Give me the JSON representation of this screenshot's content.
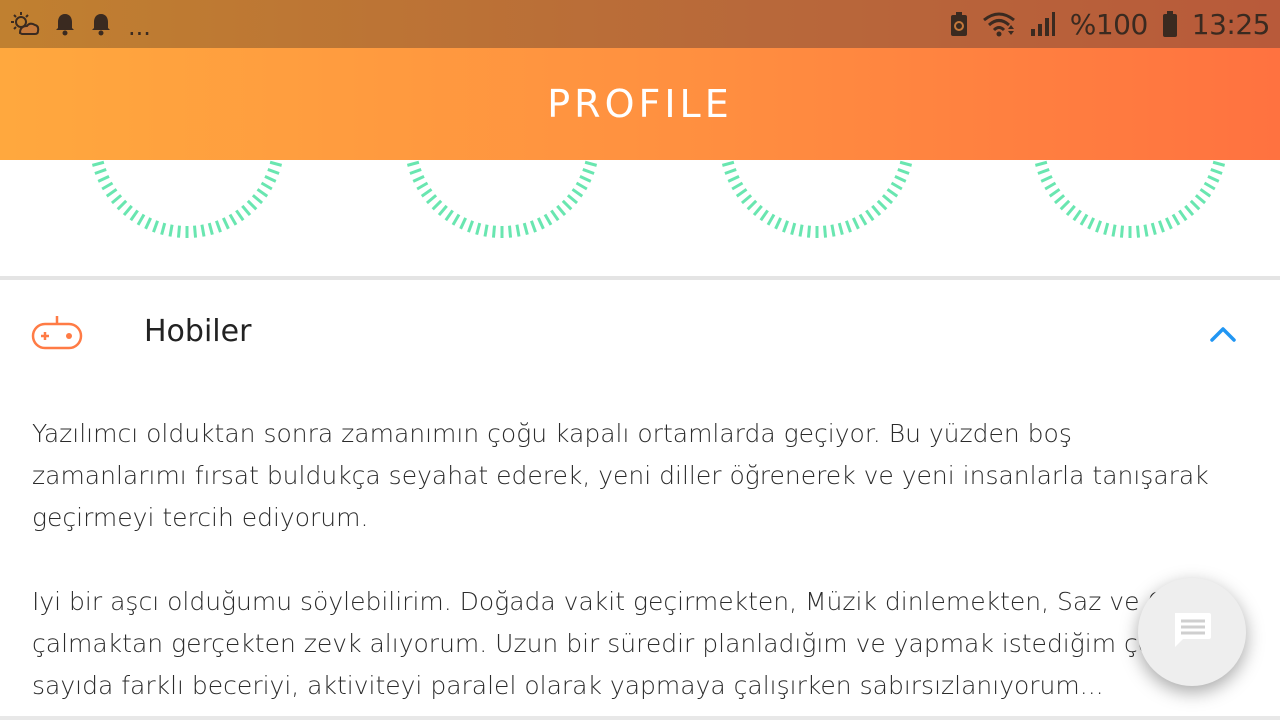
{
  "status_bar": {
    "icons_left": [
      "weather-icon",
      "notification-bell-icon",
      "notification-bell-icon"
    ],
    "overflow": "...",
    "icons_right": [
      "battery-saver-icon",
      "wifi-icon",
      "cell-signal-icon"
    ],
    "battery": "%100",
    "time": "13:25"
  },
  "app_bar": {
    "title": "PROFILE"
  },
  "gauges": {
    "count": 4,
    "color": "#69e6b0"
  },
  "section": {
    "title": "Hobiler",
    "icon": "gamepad-icon",
    "toggle_icon": "chevron-up-icon",
    "icon_color": "#ff7b45",
    "toggle_color": "#2196f3",
    "paragraphs": [
      "Yazılımcı olduktan sonra zamanımın çoğu kapalı ortamlarda geçiyor. Bu yüzden boş zamanlarımı fırsat buldukça seyahat ederek, yeni diller öğrenerek ve yeni insanlarla tanışarak geçirmeyi tercih ediyorum.",
      "Iyi bir aşcı olduğumu söylebilirim. Doğada vakit geçirmekten, Müzik dinlemekten, Saz ve Gitar çalmaktan gerçekten zevk alıyorum. Uzun bir süredir planladığım ve yapmak istediğim çok sayıda farklı beceriyi, aktiviteyi paralel olarak yapmaya çalışırken sabırsızlanıyorum..."
    ]
  },
  "fab": {
    "icon": "chat-icon"
  }
}
